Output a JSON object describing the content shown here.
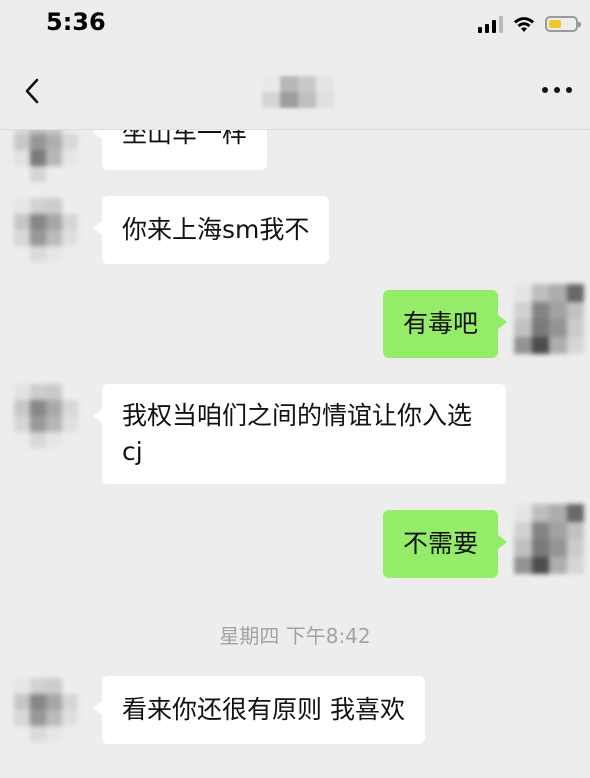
{
  "status_bar": {
    "time": "5:36",
    "battery_color": "#f3c62d"
  },
  "nav": {
    "back_icon": "chevron-left-icon",
    "more_icon": "more-dots-icon"
  },
  "colors": {
    "incoming_bubble": "#ffffff",
    "outgoing_bubble": "#95ec69",
    "background": "#ededed"
  },
  "messages": [
    {
      "side": "in",
      "text": "坐山车一样"
    },
    {
      "side": "in",
      "text": "你来上海sm我不"
    },
    {
      "side": "out",
      "text": "有毒吧"
    },
    {
      "side": "in",
      "text": "我权当咱们之间的情谊让你入选cj"
    },
    {
      "side": "out",
      "text": "不需要"
    },
    {
      "side": "timestamp",
      "text": "星期四 下午8:42"
    },
    {
      "side": "in",
      "text": "看来你还很有原则 我喜欢"
    }
  ]
}
